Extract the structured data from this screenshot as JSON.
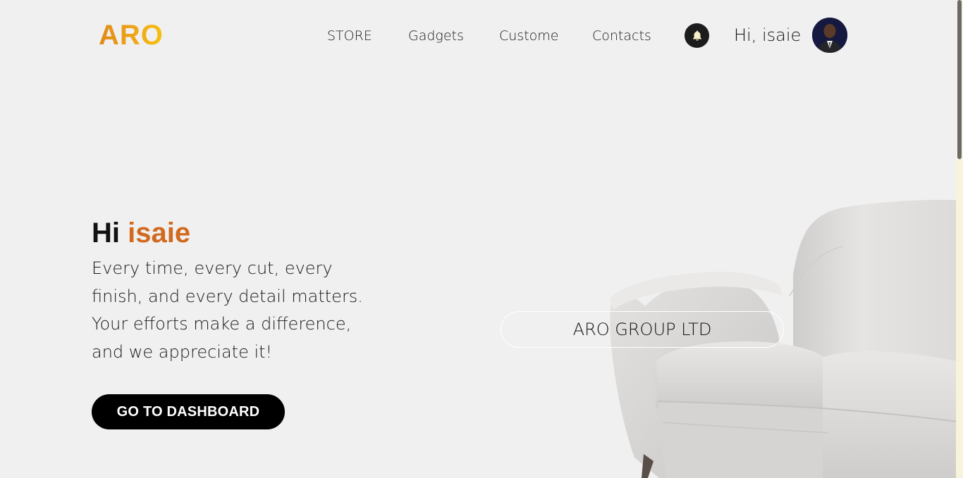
{
  "header": {
    "logo": "ARO",
    "nav": [
      {
        "label": "STORE"
      },
      {
        "label": "Gadgets"
      },
      {
        "label": "Custome"
      },
      {
        "label": "Contacts"
      }
    ],
    "greeting": "Hi, isaie",
    "icons": {
      "notifications": "bell-icon",
      "avatar": "user-avatar"
    }
  },
  "hero": {
    "title_prefix": "Hi",
    "title_name": "isaie",
    "message": "Every time, every cut, every finish, and every detail matters. Your efforts make a difference, and we appreciate it!",
    "cta_label": "GO TO DASHBOARD",
    "company_label": "ARO GROUP LTD"
  },
  "colors": {
    "background": "#f0f0f0",
    "accent": "#d2691e",
    "logo_gradient": [
      "#e08a18",
      "#f5c20f"
    ],
    "button": "#000000"
  }
}
